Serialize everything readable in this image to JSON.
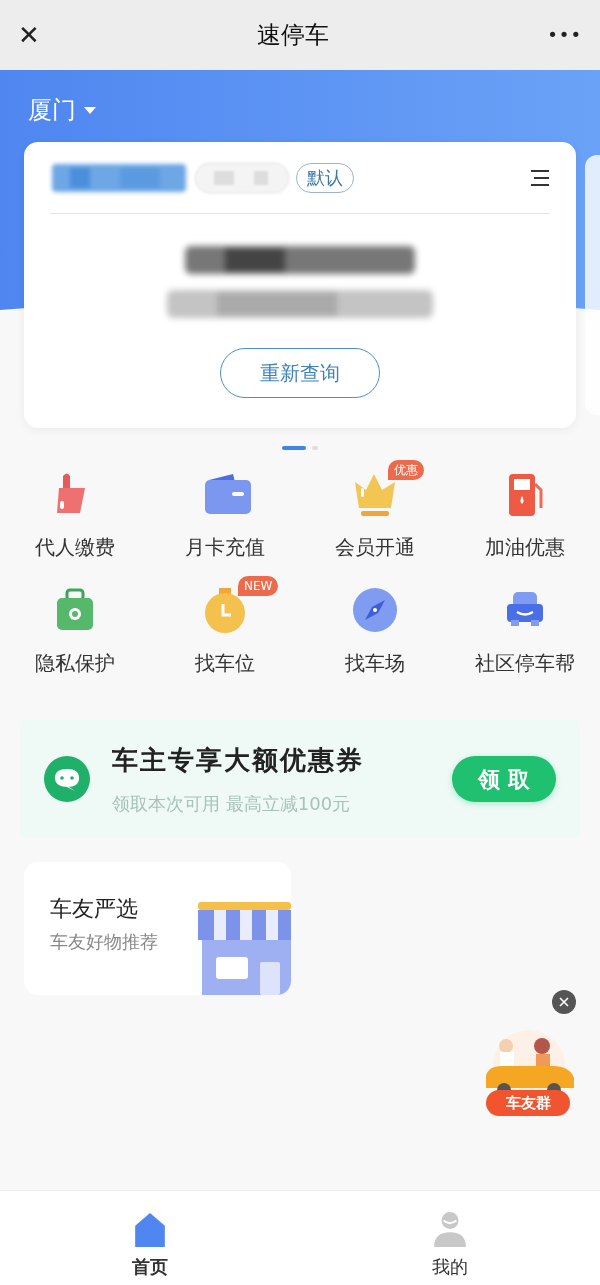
{
  "title_bar": {
    "close": "✕",
    "title": "速停车",
    "more": "•••"
  },
  "city": {
    "name": "厦门"
  },
  "plate_card": {
    "default_tag": "默认",
    "button": "重新查询"
  },
  "pager": [
    {
      "selected": true
    },
    {
      "selected": false
    }
  ],
  "services": [
    {
      "kind": "thumb",
      "label": "代人缴费"
    },
    {
      "kind": "wallet",
      "label": "月卡充值"
    },
    {
      "kind": "crown",
      "label": "会员开通",
      "badge": "优惠"
    },
    {
      "kind": "fuel",
      "label": "加油优惠"
    },
    {
      "kind": "bag",
      "label": "隐私保护"
    },
    {
      "kind": "clock",
      "label": "找车位",
      "badge": "NEW"
    },
    {
      "kind": "compass",
      "label": "找车场"
    },
    {
      "kind": "car",
      "label": "社区停车帮"
    }
  ],
  "coupon_banner": {
    "title": "车主专享大额优惠券",
    "subtitle": "领取本次可用 最高立减100元",
    "button": "领 取"
  },
  "shop_card": {
    "title": "车友严选",
    "subtitle": "车友好物推荐"
  },
  "floating_widget": {
    "label": "车友群"
  },
  "bottom_nav": [
    {
      "kind": "home",
      "label": "首页",
      "selected": true
    },
    {
      "kind": "person",
      "label": "我的",
      "selected": false
    }
  ]
}
